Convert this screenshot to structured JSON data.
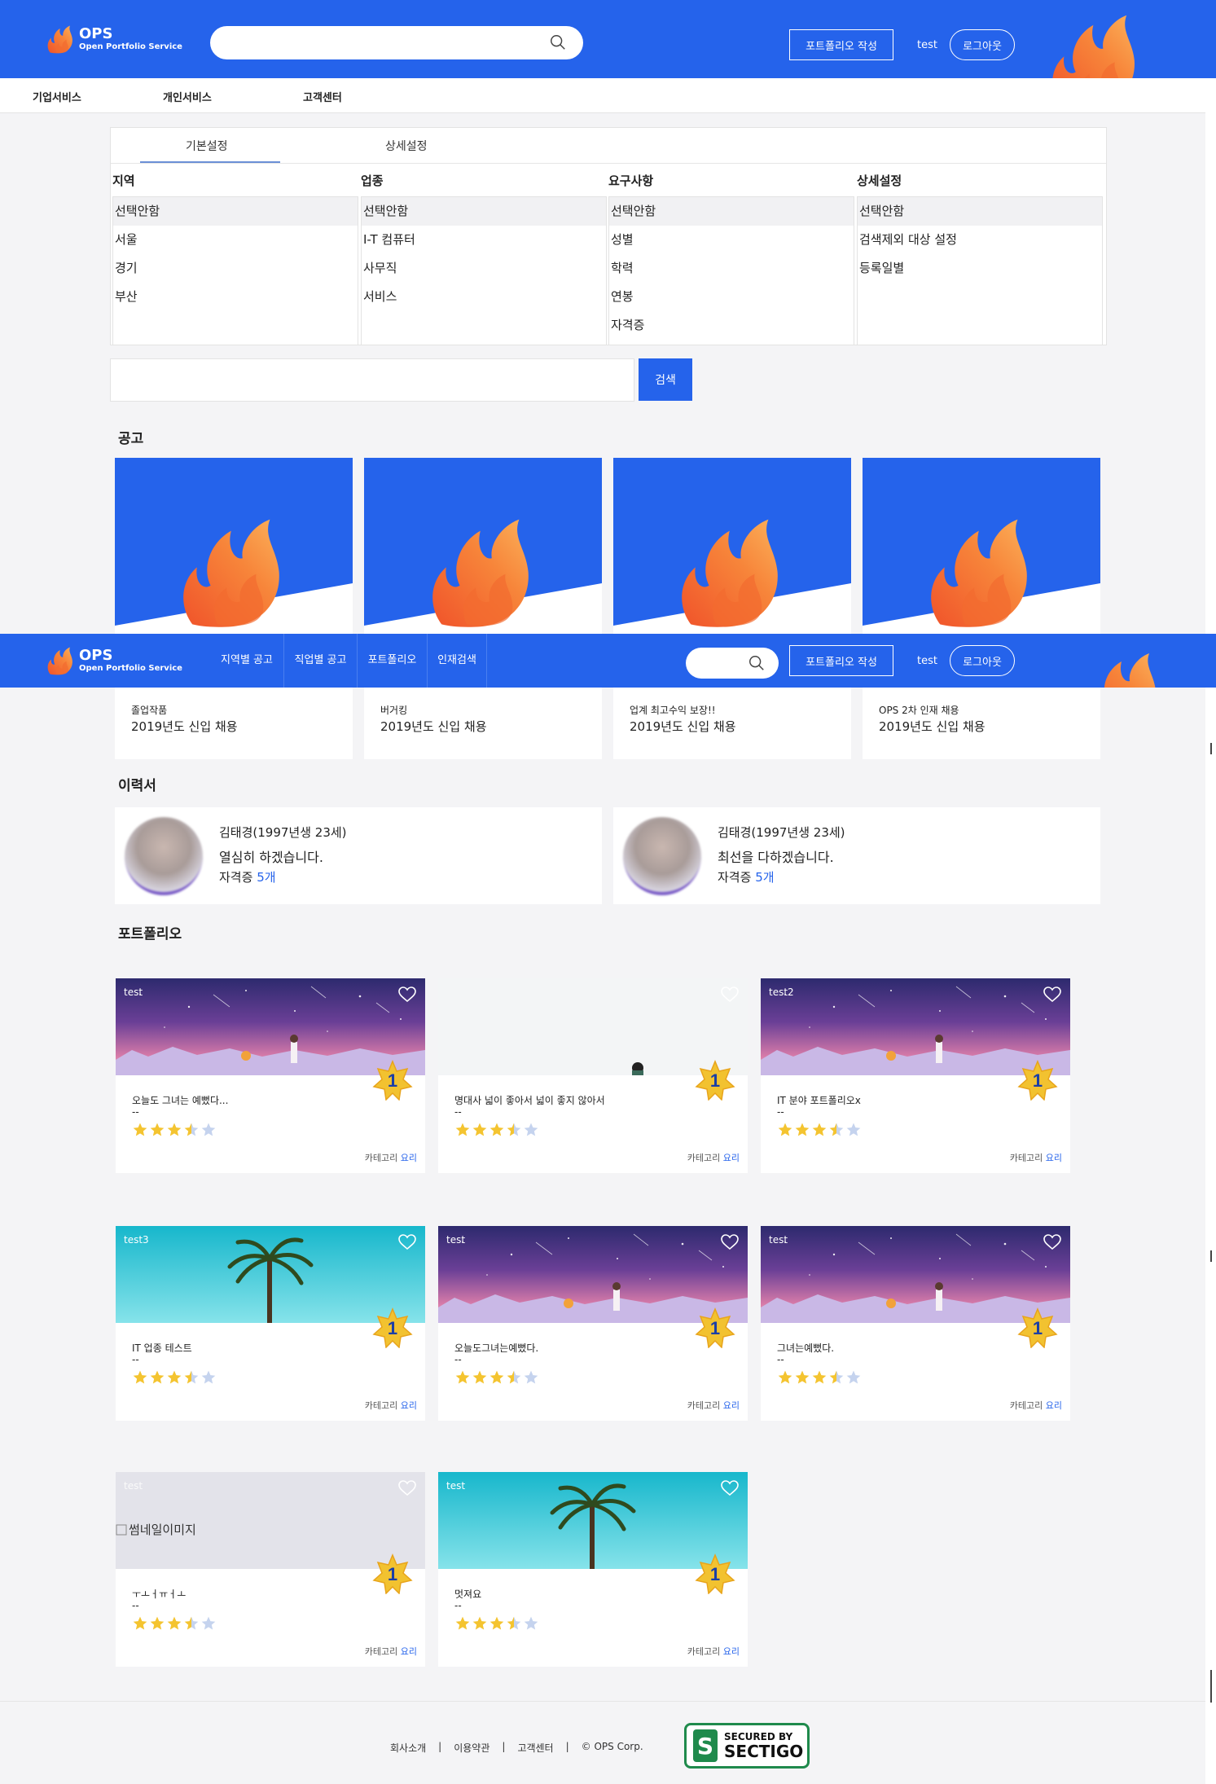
{
  "header": {
    "logo_title": "OPS",
    "logo_subtitle": "Open Portfolio Service",
    "search_placeholder": "",
    "write_portfolio": "포트폴리오 작성",
    "user": "test",
    "logout": "로그아웃"
  },
  "subnav": [
    "기업서비스",
    "개인서비스",
    "고객센터"
  ],
  "filter": {
    "tabs": [
      "기본설정",
      "상세설정"
    ],
    "columns": [
      {
        "title": "지역",
        "options": [
          "선택안함",
          "서울",
          "경기",
          "부산"
        ]
      },
      {
        "title": "업종",
        "options": [
          "선택안함",
          "I-T 컴퓨터",
          "사무직",
          "서비스"
        ]
      },
      {
        "title": "요구사항",
        "options": [
          "선택안함",
          "성별",
          "학력",
          "연봉",
          "자격증"
        ]
      },
      {
        "title": "상세설정",
        "options": [
          "선택안함",
          "검색제외 대상 설정",
          "등록일별"
        ]
      }
    ],
    "search_button": "검색"
  },
  "sections": {
    "jobs": "공고",
    "resumes": "이력서",
    "portfolios": "포트폴리오"
  },
  "jobs": [
    {
      "company": "졸업작품",
      "title": "2019년도 신입 채용"
    },
    {
      "company": "버거킹",
      "title": "2019년도 신입 채용"
    },
    {
      "company": "업계 최고수익 보장!!",
      "title": "2019년도 신입 채용"
    },
    {
      "company": "OPS 2차 인재 채용",
      "title": "2019년도 신입 채용"
    }
  ],
  "sticky_nav": {
    "logo_title": "OPS",
    "logo_subtitle": "Open Portfolio Service",
    "items": [
      "지역별 공고",
      "직업별 공고",
      "포트폴리오",
      "인재검색"
    ],
    "write_portfolio": "포트폴리오 작성",
    "user": "test",
    "logout": "로그아웃"
  },
  "resumes": [
    {
      "name": "김태경(1997년생 23세)",
      "message": "열심히 하겠습니다.",
      "cert_label": "자격증",
      "cert_count": "5개"
    },
    {
      "name": "김태경(1997년생 23세)",
      "message": "최선을 다하겠습니다.",
      "cert_label": "자격증",
      "cert_count": "5개"
    }
  ],
  "portfolios": [
    {
      "user": "test",
      "title": "오늘도 그녀는 예뻤다...",
      "sub": "--",
      "rank": "1",
      "cat_label": "카테고리",
      "cat": "요리",
      "image": "night-sky",
      "rating": 3.5
    },
    {
      "user": "",
      "title": "명대사 넓이 좋아서 넓이 좋지 않아서",
      "sub": "--",
      "rank": "1",
      "cat_label": "카테고리",
      "cat": "요리",
      "image": "white-room",
      "rating": 3.5
    },
    {
      "user": "test2",
      "title": "IT 분야 포트폴리오x",
      "sub": "--",
      "rank": "1",
      "cat_label": "카테고리",
      "cat": "요리",
      "image": "night-sky",
      "rating": 3.5
    },
    {
      "user": "test3",
      "title": "IT 업종 테스트",
      "sub": "--",
      "rank": "1",
      "cat_label": "카테고리",
      "cat": "요리",
      "image": "palm-tree",
      "rating": 3.5
    },
    {
      "user": "test",
      "title": "오늘도그녀는예뻤다.",
      "sub": "--",
      "rank": "1",
      "cat_label": "카테고리",
      "cat": "요리",
      "image": "night-sky",
      "rating": 3.5
    },
    {
      "user": "test",
      "title": "그녀는예뻤다.",
      "sub": "--",
      "rank": "1",
      "cat_label": "카테고리",
      "cat": "요리",
      "image": "night-sky",
      "rating": 3.5
    },
    {
      "user": "test",
      "title": "ㅜㅗㅓㅠㅓㅗ",
      "sub": "--",
      "rank": "1",
      "cat_label": "카테고리",
      "cat": "요리",
      "image": "broken",
      "broken_alt": "썸네일이미지",
      "rating": 3.5
    },
    {
      "user": "test",
      "title": "멋져요",
      "sub": "--",
      "rank": "1",
      "cat_label": "카테고리",
      "cat": "요리",
      "image": "palm-tree",
      "rating": 3.5
    }
  ],
  "footer": {
    "links": [
      "회사소개",
      "|",
      "이용약관",
      "|",
      "고객센터",
      "|",
      "© OPS Corp."
    ],
    "badge_top": "SECURED BY",
    "badge_bottom": "SECTIGO"
  },
  "colors": {
    "primary": "#2563eb",
    "flame": "#f97316",
    "star": "#f4c430",
    "star_empty": "#c5d3ee"
  }
}
